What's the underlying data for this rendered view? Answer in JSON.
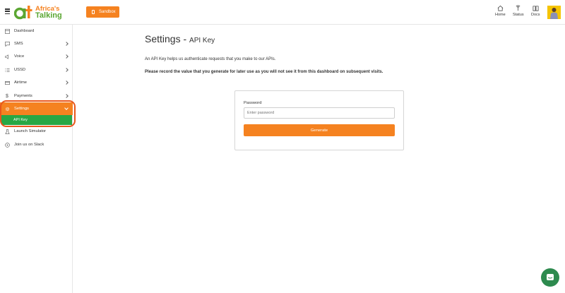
{
  "header": {
    "brand_line1": "Africa's",
    "brand_line2": "Talking",
    "sandbox_label": "Sandbox",
    "nav": [
      {
        "label": "Home",
        "icon": "home-icon"
      },
      {
        "label": "Status",
        "icon": "status-icon"
      },
      {
        "label": "Docs",
        "icon": "docs-icon"
      }
    ]
  },
  "sidebar": {
    "items": [
      {
        "label": "Dashboard",
        "icon": "dashboard-icon"
      },
      {
        "label": "SMS",
        "icon": "sms-icon"
      },
      {
        "label": "Voice",
        "icon": "voice-icon"
      },
      {
        "label": "USSD",
        "icon": "ussd-icon"
      },
      {
        "label": "Airtime",
        "icon": "airtime-icon"
      },
      {
        "label": "Payments",
        "icon": "dollar-icon"
      },
      {
        "label": "Settings",
        "icon": "gear-icon"
      },
      {
        "label": "Launch Simulator",
        "icon": "flask-icon"
      },
      {
        "label": "Join us on Slack",
        "icon": "chat-icon"
      }
    ],
    "sub_item": "API Key"
  },
  "main": {
    "title": "Settings - ",
    "subtitle": "API Key",
    "description": "An API Key helps us authenticate requests that you make to our APIs.",
    "warning": "Please record the value that you generate for later use as you will not see it from this dashboard on subsequent visits.",
    "form": {
      "password_label": "Password",
      "password_placeholder": "Enter password",
      "generate_label": "Generate"
    }
  },
  "colors": {
    "accent": "#f58220",
    "green": "#28a745",
    "ring": "#e8561c"
  }
}
